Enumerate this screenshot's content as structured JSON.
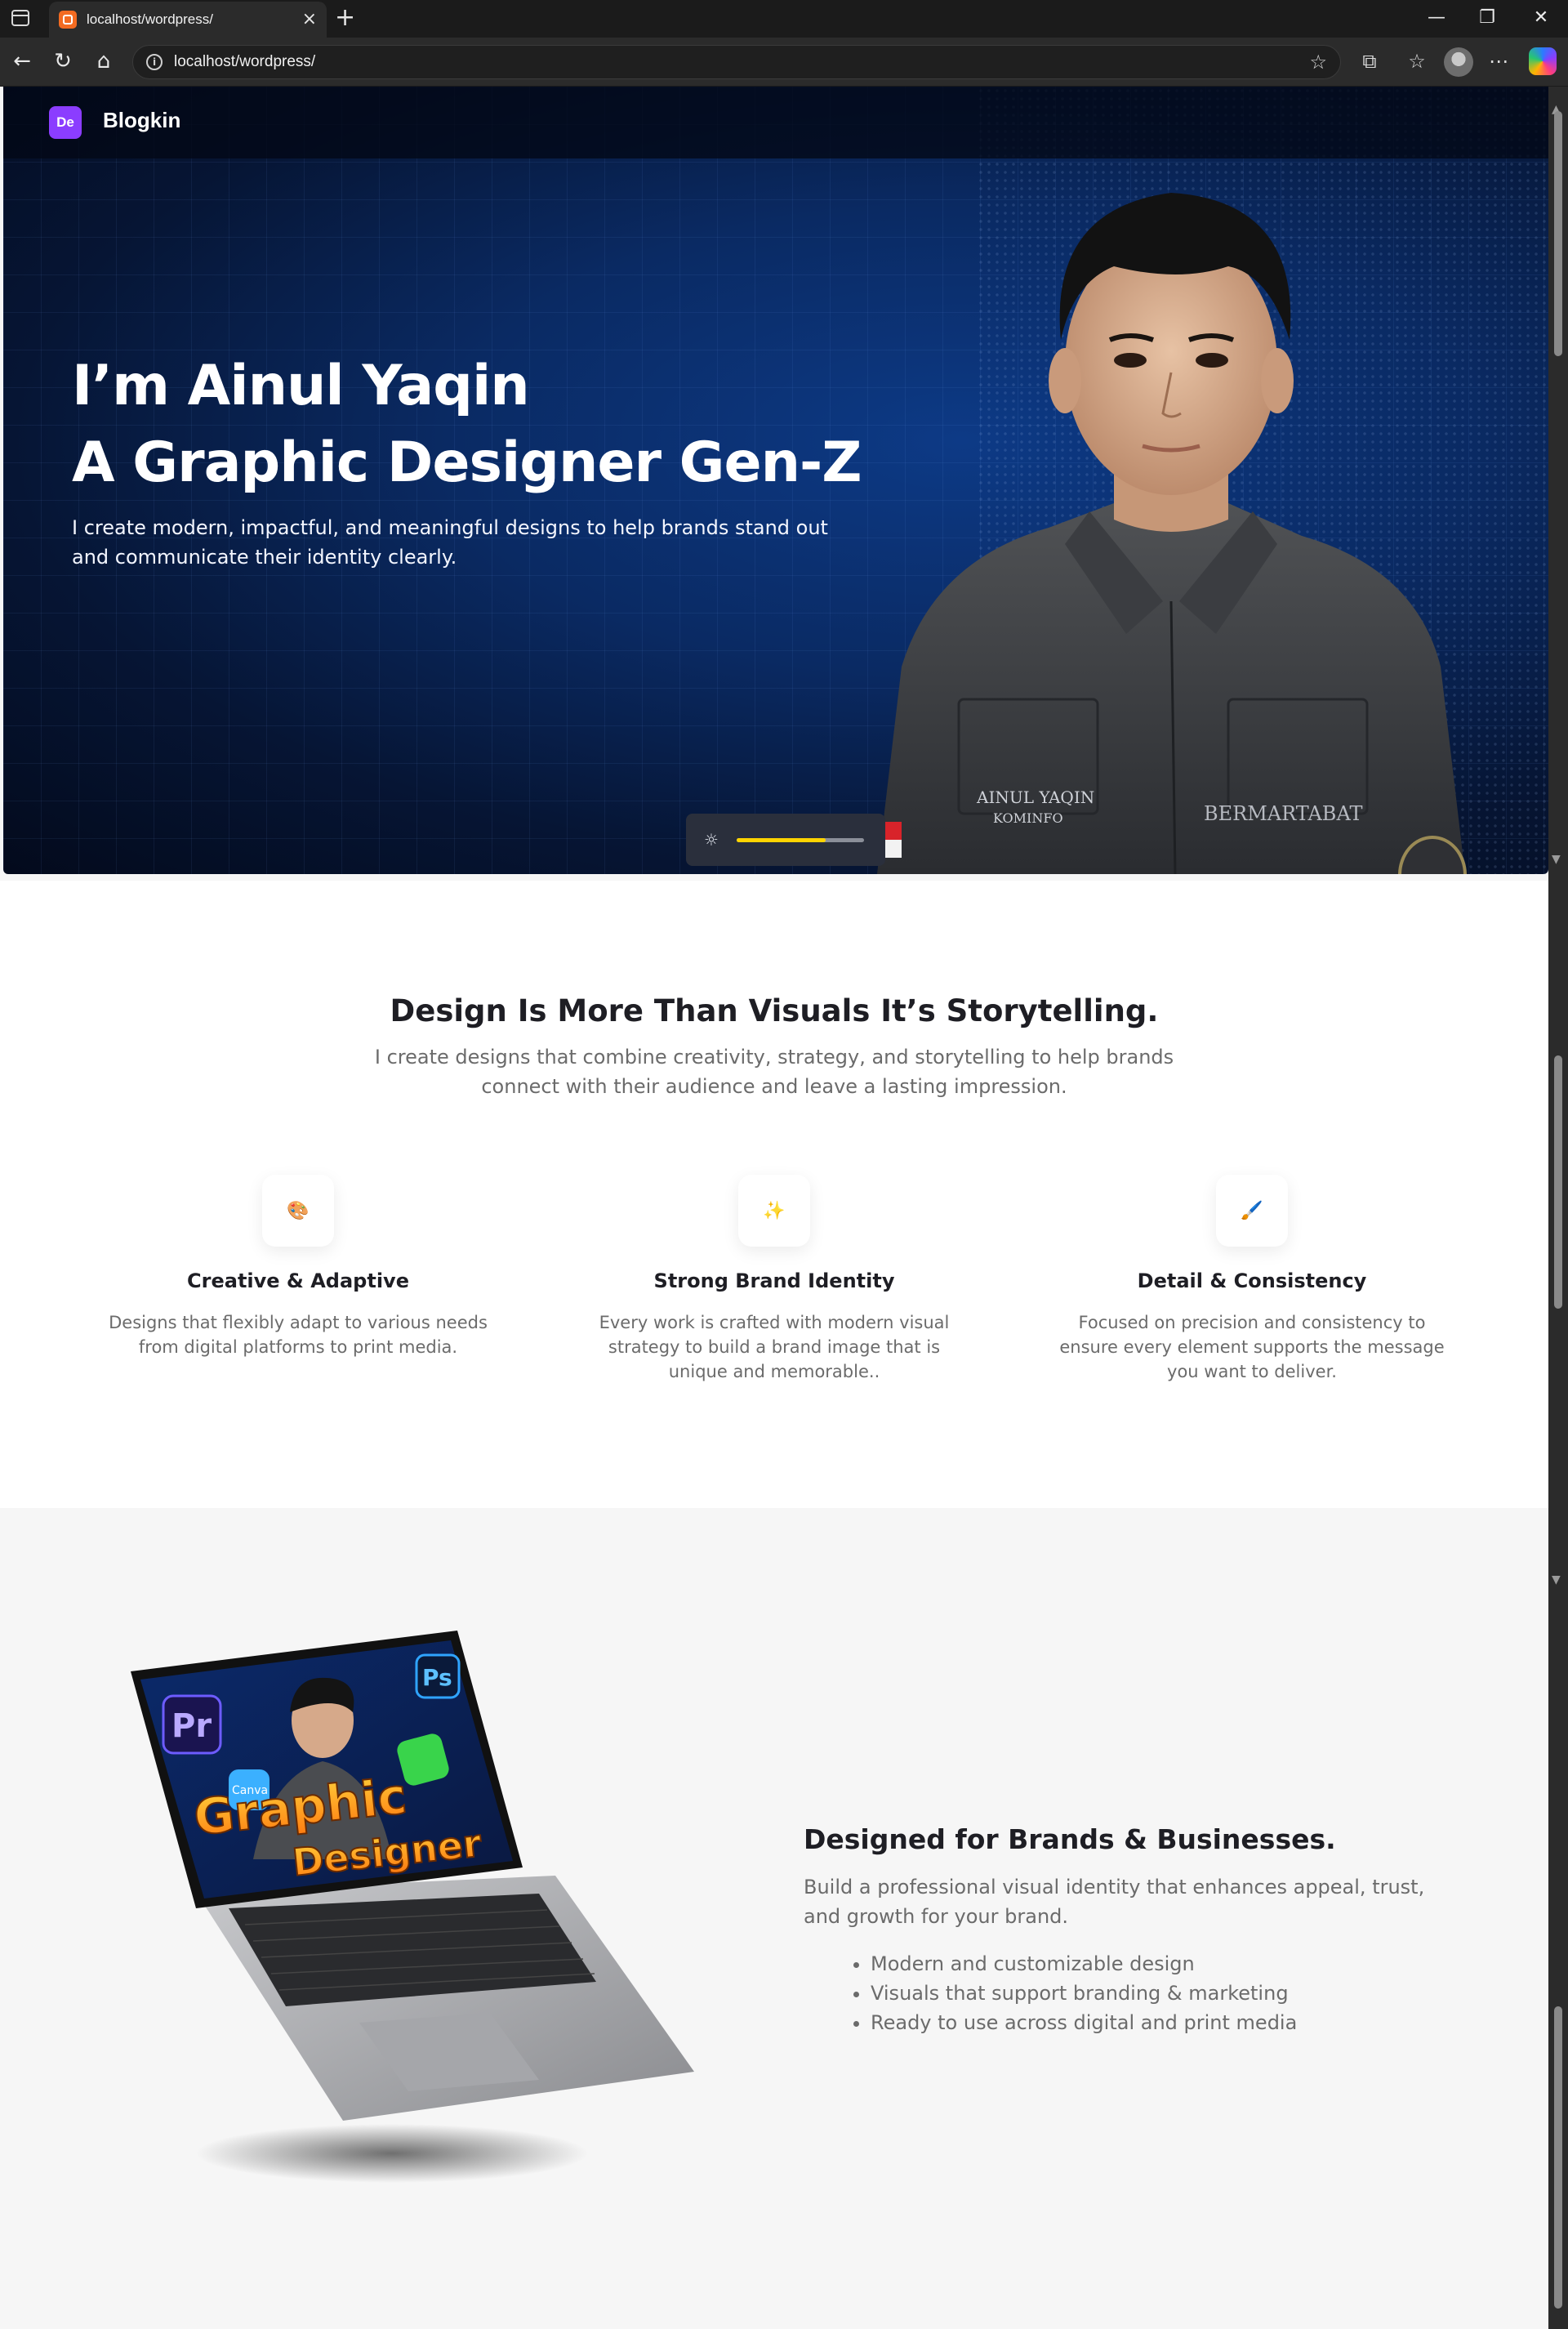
{
  "browser": {
    "tab_title": "localhost/wordpress/",
    "url": "localhost/wordpress/",
    "new_tab": "+",
    "close_tab": "×"
  },
  "site": {
    "logo_mark": "De",
    "logo_text": "Blogkin"
  },
  "hero": {
    "title_line1": "I’m Ainul Yaqin",
    "title_line2": "A Graphic Designer Gen-Z",
    "subtitle": "I create modern, impactful, and meaningful designs to help brands stand out and communicate their identity clearly.",
    "badge_name": "AINUL YAQIN",
    "badge_org": "KOMINFO",
    "badge_right": "BERMARTABAT",
    "brightness_level": 0.7,
    "accent_color": "#ffd400"
  },
  "storytelling": {
    "title": "Design Is More Than Visuals It’s Storytelling.",
    "subtitle": "I create designs that combine creativity, strategy, and storytelling to help brands connect with their audience and leave a lasting impression.",
    "features": [
      {
        "icon": "🎨",
        "title": "Creative & Adaptive",
        "text": "Designs that flexibly adapt to various needs from digital platforms to print media."
      },
      {
        "icon": "✨",
        "title": "Strong Brand Identity",
        "text": "Every work is crafted with modern visual strategy to build a brand image that is unique and memorable.."
      },
      {
        "icon": "🖌️",
        "title": "Detail & Consistency",
        "text": "Focused on precision and consistency to ensure every element supports the message you want to deliver."
      }
    ]
  },
  "brands": {
    "title": "Designed for Brands & Businesses.",
    "subtitle": "Build a professional visual identity that enhances appeal, trust, and growth for your brand.",
    "bullets": [
      "Modern and customizable design",
      "Visuals that support branding & marketing",
      "Ready to use across digital and print media"
    ],
    "laptop_screen": {
      "pr": "Pr",
      "ps": "Ps",
      "canva": "Canva",
      "word1": "Graphic",
      "word2": "Designer"
    }
  }
}
